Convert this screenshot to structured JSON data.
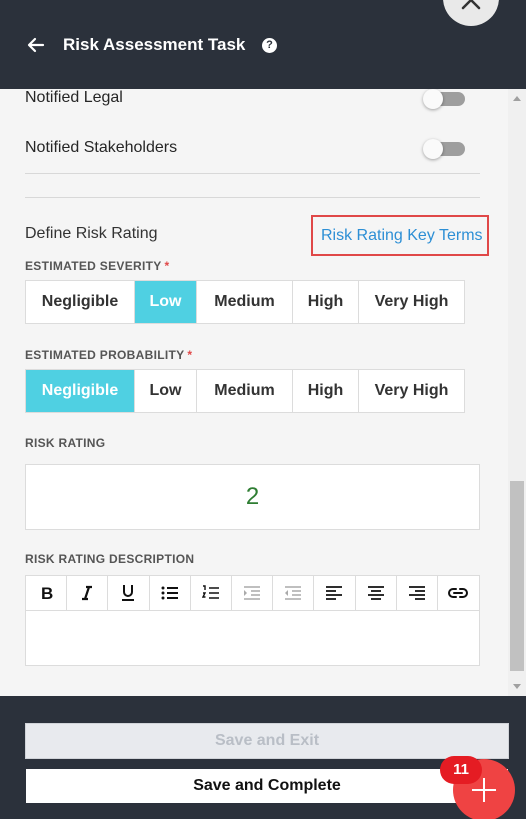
{
  "header": {
    "title": "Risk Assessment Task",
    "help_glyph": "?"
  },
  "toggles": [
    {
      "label": "Notified Legal",
      "on": false
    },
    {
      "label": "Notified Stakeholders",
      "on": false
    }
  ],
  "risk_section": {
    "title": "Define Risk Rating",
    "key_terms_link": "Risk Rating Key Terms"
  },
  "severity": {
    "label": "ESTIMATED SEVERITY",
    "required_mark": "*",
    "options": [
      "Negligible",
      "Low",
      "Medium",
      "High",
      "Very High"
    ],
    "selected": "Low"
  },
  "probability": {
    "label": "ESTIMATED PROBABILITY",
    "required_mark": "*",
    "options": [
      "Negligible",
      "Low",
      "Medium",
      "High",
      "Very High"
    ],
    "selected": "Negligible"
  },
  "rating": {
    "label": "RISK RATING",
    "value": "2",
    "value_color": "#2e7d32"
  },
  "description": {
    "label": "RISK RATING DESCRIPTION",
    "toolbar": [
      "bold-icon",
      "italic-icon",
      "underline-icon",
      "bullet-list-icon",
      "numbered-list-icon",
      "indent-icon",
      "outdent-icon",
      "align-left-icon",
      "align-center-icon",
      "align-right-icon",
      "link-icon"
    ]
  },
  "footer": {
    "save_exit_label": "Save and Exit",
    "save_complete_label": "Save and Complete"
  },
  "fab": {
    "badge_count": "11",
    "icon": "plus-icon"
  },
  "colors": {
    "header_bg": "#2b313b",
    "accent": "#4fd0e2",
    "link": "#2d8fd5",
    "highlight_border": "#e04848",
    "fab": "#ef4343"
  }
}
